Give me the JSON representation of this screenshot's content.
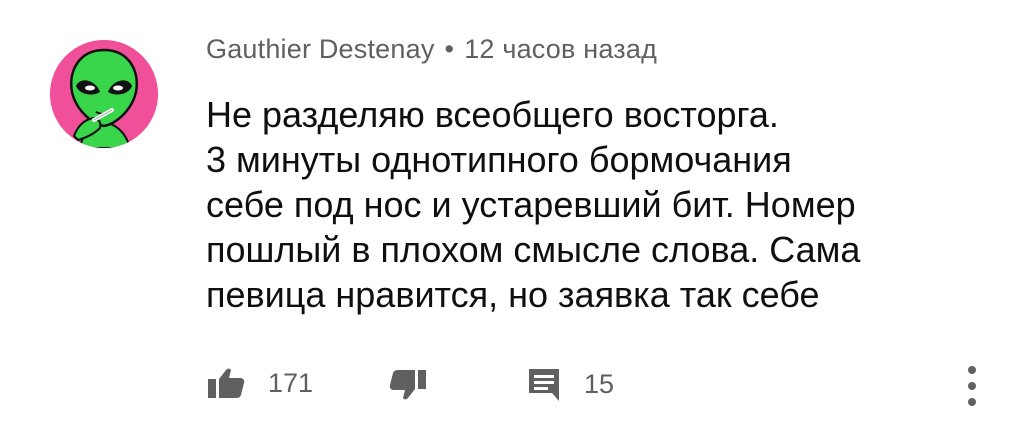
{
  "comment": {
    "author": "Gauthier Destenay",
    "separator": "•",
    "time": "12 часов назад",
    "lines": [
      "Не разделяю всеобщего восторга.",
      "3 минуты однотипного бормочания",
      "себе под нос и устаревший бит. Номер",
      "пошлый в плохом смысле слова. Сама",
      "певица нравится, но заявка так себе"
    ],
    "likes": "171",
    "replies": "15"
  },
  "icons": {
    "avatar": "green-alien-avatar",
    "like": "thumbs-up-icon",
    "dislike": "thumbs-down-icon",
    "reply": "reply-comment-icon",
    "more": "more-vertical-icon"
  },
  "colors": {
    "avatar_bg": "#f0509a",
    "alien_skin": "#39d54a",
    "text": "#0f0f0f",
    "secondary": "#606060"
  }
}
